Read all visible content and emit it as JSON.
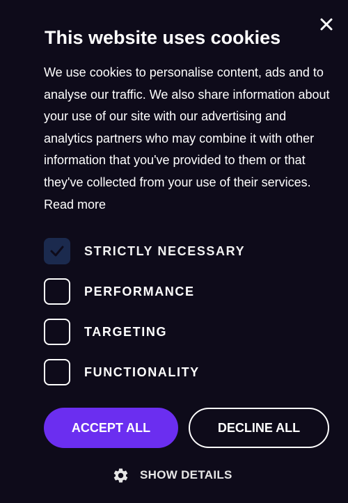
{
  "dialog": {
    "title": "This website uses cookies",
    "body": "We use cookies to personalise content, ads and to analyse our traffic. We also share information about your use of our site with our advertising and analytics partners who may combine it with other information that you've provided to them or that they've collected from your use of their services.",
    "read_more": "Read more",
    "close_icon": "close-icon"
  },
  "options": [
    {
      "label": "STRICTLY NECESSARY",
      "checked": true,
      "disabled": true
    },
    {
      "label": "PERFORMANCE",
      "checked": false,
      "disabled": false
    },
    {
      "label": "TARGETING",
      "checked": false,
      "disabled": false
    },
    {
      "label": "FUNCTIONALITY",
      "checked": false,
      "disabled": false
    }
  ],
  "buttons": {
    "accept_all": "ACCEPT ALL",
    "decline_all": "DECLINE ALL"
  },
  "show_details": {
    "label": "SHOW DETAILS",
    "icon": "gear-icon"
  },
  "colors": {
    "background": "#0e0b1a",
    "accent": "#6b2ef0",
    "checked_box": "#1b2a4e",
    "text": "#ffffff"
  }
}
